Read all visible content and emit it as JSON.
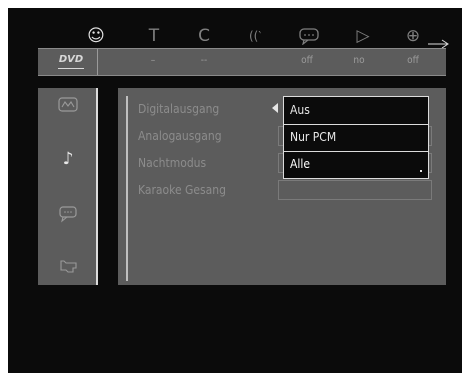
{
  "top_icons": [
    {
      "name": "child-face-icon",
      "glyph": "☺",
      "selected": true
    },
    {
      "name": "title-icon",
      "glyph": "T",
      "selected": false
    },
    {
      "name": "chapter-icon",
      "glyph": "C",
      "selected": false
    },
    {
      "name": "audio-waves-icon",
      "glyph": "((‵",
      "selected": false
    },
    {
      "name": "subtitle-bubble-icon",
      "glyph": "…",
      "selected": false
    },
    {
      "name": "angle-arrow-icon",
      "glyph": "▷",
      "selected": false
    },
    {
      "name": "zoom-icon",
      "glyph": "⊕",
      "selected": false
    }
  ],
  "status_bar": {
    "disc_logo": "DVD",
    "values": [
      "–",
      "--",
      "off",
      "no",
      "off"
    ]
  },
  "side_menu": [
    {
      "name": "picture-settings-icon",
      "glyph": "∿",
      "selected": false
    },
    {
      "name": "sound-settings-icon",
      "glyph": "♪",
      "selected": true
    },
    {
      "name": "language-settings-icon",
      "glyph": "☷",
      "selected": false
    },
    {
      "name": "features-settings-icon",
      "glyph": "☜",
      "selected": false
    }
  ],
  "settings": {
    "items": [
      {
        "label": "Digitalausgang"
      },
      {
        "label": "Analogausgang"
      },
      {
        "label": "Nachtmodus"
      },
      {
        "label": "Karaoke Gesang"
      }
    ]
  },
  "dropdown": {
    "options": [
      "Aus",
      "Nur PCM",
      "Alle"
    ],
    "highlighted_index": 2
  },
  "colors": {
    "panel": "#5c5c5c",
    "background": "#0b0b0b",
    "highlight": "#ffffff"
  }
}
